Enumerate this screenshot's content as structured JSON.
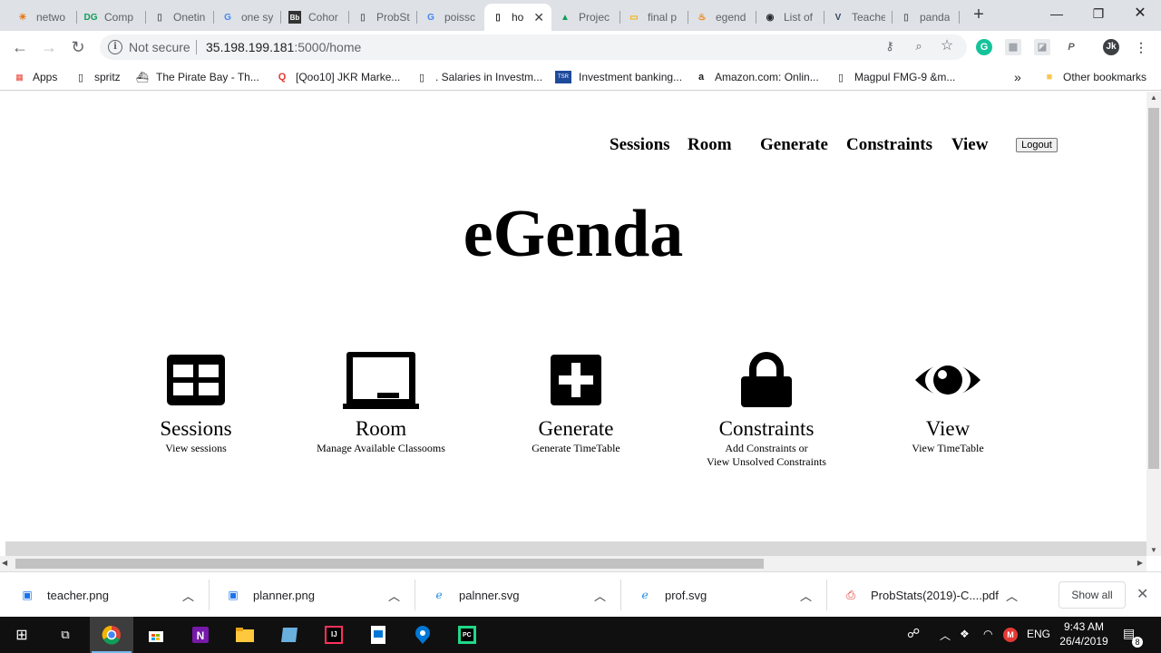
{
  "browser": {
    "tabs": [
      {
        "title": "netwo",
        "icon": "sun-icon",
        "glyph": "☀",
        "color": "#e8710a"
      },
      {
        "title": "Comp",
        "icon": "dg-icon",
        "glyph": "DG",
        "color": "#0f9d58"
      },
      {
        "title": "Onetin",
        "icon": "page-icon",
        "glyph": "▯",
        "color": "#5f6368"
      },
      {
        "title": "one sy",
        "icon": "google-icon",
        "glyph": "G",
        "color": "#4285f4"
      },
      {
        "title": "Cohor",
        "icon": "blackboard-icon",
        "glyph": "Bb",
        "color": "#333333"
      },
      {
        "title": "ProbSt",
        "icon": "page-icon",
        "glyph": "▯",
        "color": "#5f6368"
      },
      {
        "title": "poissc",
        "icon": "google-icon",
        "glyph": "G",
        "color": "#4285f4"
      },
      {
        "title": "ho",
        "icon": "page-icon",
        "glyph": "▯",
        "color": "#5f6368",
        "active": true
      },
      {
        "title": "Projec",
        "icon": "drive-icon",
        "glyph": "▲",
        "color": "#0f9d58"
      },
      {
        "title": "final p",
        "icon": "slides-icon",
        "glyph": "▭",
        "color": "#f4b400"
      },
      {
        "title": "egend",
        "icon": "fire-icon",
        "glyph": "🔥",
        "color": "#f57c00"
      },
      {
        "title": "List of",
        "icon": "github-icon",
        "glyph": "◉",
        "color": "#24292e"
      },
      {
        "title": "Teache",
        "icon": "vue-icon",
        "glyph": "V",
        "color": "#35495e"
      },
      {
        "title": "panda",
        "icon": "page-icon",
        "glyph": "▯",
        "color": "#5f6368"
      }
    ],
    "address": {
      "security": "Not secure",
      "host": "35.198.199.181",
      "path": ":5000/home"
    },
    "profile_initials": "Jk",
    "bookmarks": [
      {
        "label": "Apps",
        "icon": "apps-icon",
        "glyph": "⋮⋮⋮",
        "color": "#ea4335"
      },
      {
        "label": "spritz",
        "icon": "page-icon",
        "glyph": "▯",
        "color": "#5f6368"
      },
      {
        "label": "The Pirate Bay - Th...",
        "icon": "ship-icon",
        "glyph": "⛵",
        "color": "#202124"
      },
      {
        "label": "[Qoo10] JKR Marke...",
        "icon": "qoo10-icon",
        "glyph": "Q",
        "color": "#e53935"
      },
      {
        "label": ". Salaries in Investm...",
        "icon": "page-icon",
        "glyph": "▯",
        "color": "#5f6368"
      },
      {
        "label": "Investment banking...",
        "icon": "tsr-icon",
        "glyph": "TSR",
        "color": "#1e4a9c"
      },
      {
        "label": "Amazon.com: Onlin...",
        "icon": "amazon-icon",
        "glyph": "a",
        "color": "#000000"
      },
      {
        "label": "Magpul FMG-9 &m...",
        "icon": "page-icon",
        "glyph": "▯",
        "color": "#5f6368"
      }
    ],
    "bookmarks_overflow": "»",
    "other_bookmarks": "Other bookmarks"
  },
  "site": {
    "nav": {
      "sessions": "Sessions",
      "room": "Room",
      "generate": "Generate",
      "constraints": "Constraints",
      "view": "View",
      "logout": "Logout"
    },
    "brand": "eGenda",
    "features": [
      {
        "title": "Sessions",
        "desc": "View sessions",
        "icon": "table-icon"
      },
      {
        "title": "Room",
        "desc": "Manage Available Classooms",
        "icon": "blackboard-icon"
      },
      {
        "title": "Generate",
        "desc": "Generate TimeTable",
        "icon": "plus-square-icon"
      },
      {
        "title": "Constraints",
        "desc": "Add Constraints or",
        "desc2": "View Unsolved Constraints",
        "icon": "lock-icon"
      },
      {
        "title": "View",
        "desc": "View TimeTable",
        "icon": "eye-icon"
      }
    ]
  },
  "downloads": {
    "items": [
      {
        "name": "teacher.png",
        "icon": "image-file-icon"
      },
      {
        "name": "planner.png",
        "icon": "image-file-icon"
      },
      {
        "name": "palnner.svg",
        "icon": "ie-file-icon"
      },
      {
        "name": "prof.svg",
        "icon": "ie-file-icon"
      },
      {
        "name": "ProbStats(2019)-C....pdf",
        "icon": "pdf-file-icon"
      }
    ],
    "show_all": "Show all"
  },
  "taskbar": {
    "language": "ENG",
    "time": "9:43 AM",
    "date": "26/4/2019",
    "notifications": "8"
  }
}
